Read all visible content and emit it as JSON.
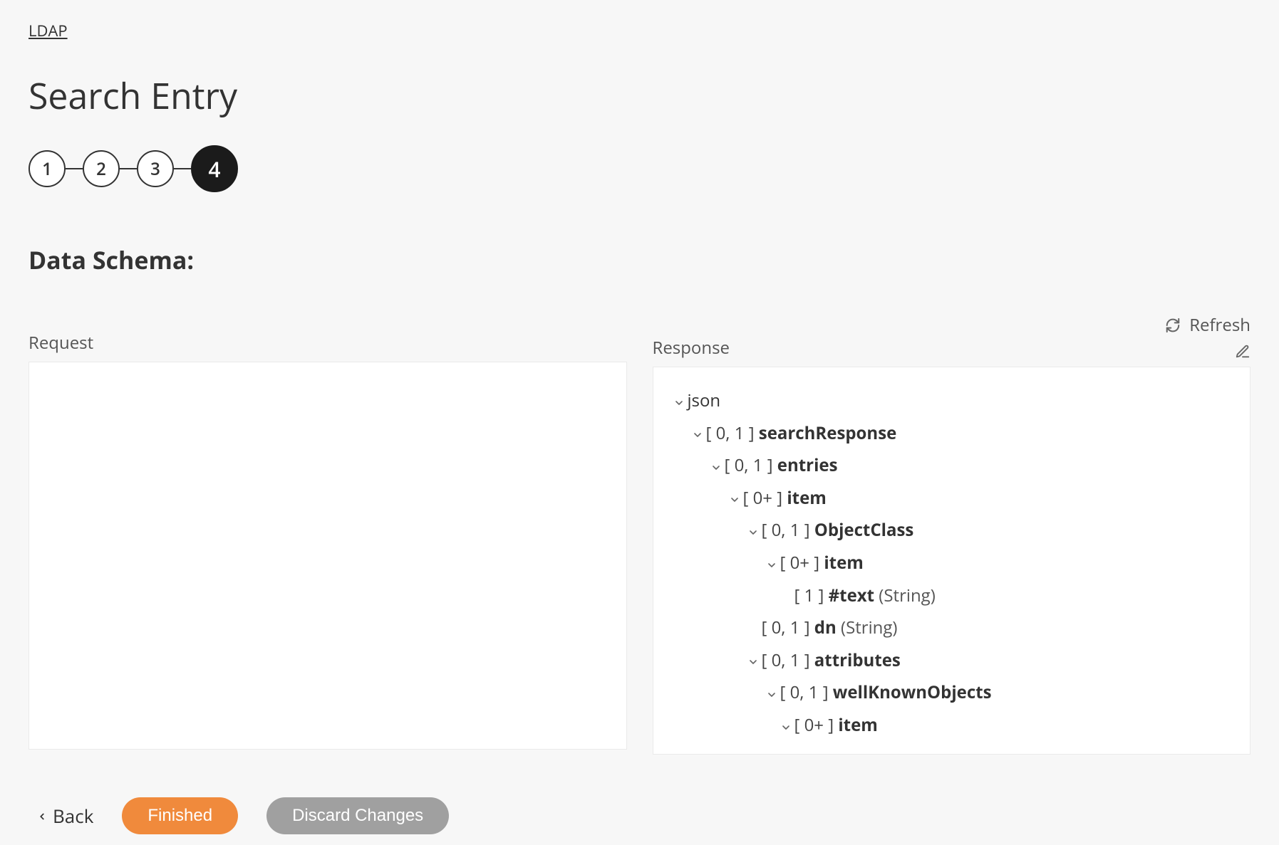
{
  "breadcrumb": {
    "label": "LDAP"
  },
  "page": {
    "title": "Search Entry"
  },
  "stepper": {
    "steps": [
      "1",
      "2",
      "3",
      "4"
    ],
    "active_index": 3
  },
  "section": {
    "title": "Data Schema:"
  },
  "request_panel": {
    "label": "Request"
  },
  "response_panel": {
    "label": "Response",
    "refresh_label": "Refresh",
    "tree": [
      {
        "indent": 0,
        "chevron": true,
        "card": "",
        "name": "json",
        "bold": false,
        "type": ""
      },
      {
        "indent": 1,
        "chevron": true,
        "card": "[ 0, 1 ]",
        "name": "searchResponse",
        "bold": true,
        "type": ""
      },
      {
        "indent": 2,
        "chevron": true,
        "card": "[ 0, 1 ]",
        "name": "entries",
        "bold": true,
        "type": ""
      },
      {
        "indent": 3,
        "chevron": true,
        "card": "[ 0+ ]",
        "name": "item",
        "bold": true,
        "type": ""
      },
      {
        "indent": 4,
        "chevron": true,
        "card": "[ 0, 1 ]",
        "name": "ObjectClass",
        "bold": true,
        "type": ""
      },
      {
        "indent": 5,
        "chevron": true,
        "card": "[ 0+ ]",
        "name": "item",
        "bold": true,
        "type": ""
      },
      {
        "indent": 6,
        "chevron": false,
        "card": "[ 1 ]",
        "name": "#text",
        "bold": true,
        "type": "(String)"
      },
      {
        "indent": 4,
        "chevron": false,
        "card": "[ 0, 1 ]",
        "name": "dn",
        "bold": true,
        "type": "(String)"
      },
      {
        "indent": 4,
        "chevron": true,
        "card": "[ 0, 1 ]",
        "name": "attributes",
        "bold": true,
        "type": ""
      },
      {
        "indent": 5,
        "chevron": true,
        "card": "[ 0, 1 ]",
        "name": "wellKnownObjects",
        "bold": true,
        "type": ""
      },
      {
        "indent": 6,
        "chevron": true,
        "card": "[ 0+ ]",
        "name": "item",
        "bold": true,
        "type": ""
      }
    ]
  },
  "footer": {
    "back_label": "Back",
    "finished_label": "Finished",
    "discard_label": "Discard Changes"
  },
  "colors": {
    "accent": "#f08a3c",
    "muted_button": "#a0a0a0",
    "step_active": "#1b1b1b"
  }
}
